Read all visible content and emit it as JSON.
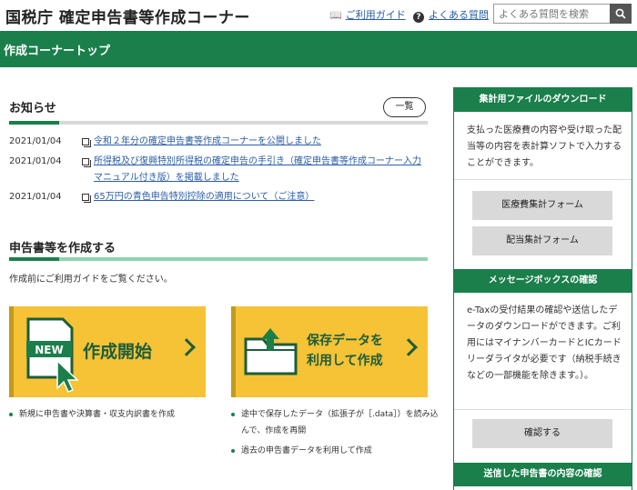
{
  "header": {
    "site_title": "国税庁 確定申告書等作成コーナー",
    "guide_link": "ご利用ガイド",
    "faq_link": "よくある質問",
    "search_placeholder": "よくある質問を検索"
  },
  "band": {
    "title": "作成コーナートップ"
  },
  "news": {
    "heading": "お知らせ",
    "list_button": "一覧",
    "items": [
      {
        "date": "2021/01/04",
        "text": "令和２年分の確定申告書等作成コーナーを公開しました"
      },
      {
        "date": "2021/01/04",
        "text": "所得税及び復興特別所得税の確定申告の手引き（確定申告書等作成コーナー入力マニュアル付き版）を掲載しました"
      },
      {
        "date": "2021/01/04",
        "text": "65万円の青色申告特別控除の適用について（ご注意）"
      }
    ]
  },
  "create": {
    "heading": "申告書等を作成する",
    "intro": "作成前にご利用ガイドをご覧ください。",
    "new_tile": {
      "badge": "NEW",
      "label": "作成開始"
    },
    "saved_tile": {
      "line1": "保存データを",
      "line2": "利用して作成"
    },
    "new_bullets": [
      "新規に申告書や決算書・収支内訳書を作成"
    ],
    "saved_bullets": [
      "途中で保存したデータ（拡張子が［.data］）を読み込んで、作成を再開",
      "過去の申告書データを利用して作成"
    ]
  },
  "side": {
    "download_heading": "集計用ファイルのダウンロード",
    "download_text": "支払った医療費の内容や受け取った配当等の内容を表計算ソフトで入力することができます。",
    "medical_button": "医療費集計フォーム",
    "dividend_button": "配当集計フォーム",
    "message_heading": "メッセージボックスの確認",
    "message_text": "e-Taxの受付結果の確認や送信したデータのダウンロードができます。ご利用にはマイナンバーカードとICカードリーダライタが必要です（納税手続きなどの一部機能を除きます。）。",
    "confirm_button": "確認する",
    "sent_heading": "送信した申告書の内容の確認"
  },
  "colors": {
    "brand_green": "#1a7f4b",
    "tile_yellow": "#f6c236",
    "link_blue": "#2a5da8"
  }
}
